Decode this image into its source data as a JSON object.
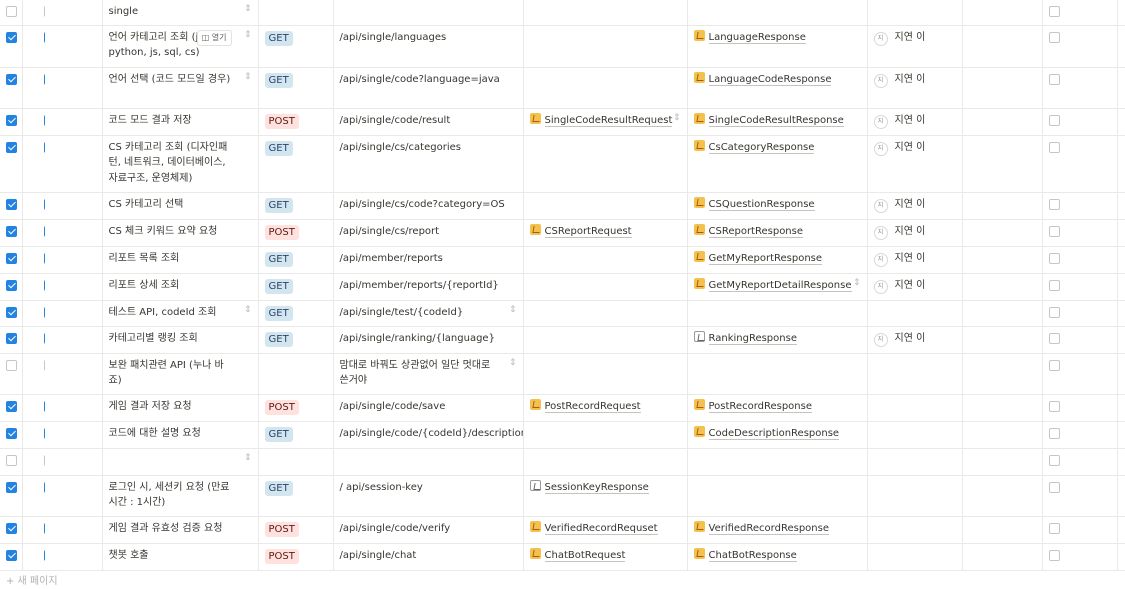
{
  "rows": [
    {
      "chk_a": false,
      "chk_b": false,
      "name": "single",
      "method": "",
      "url": "",
      "request": "",
      "response": "",
      "status": "",
      "chk_c": false
    },
    {
      "chk_a": true,
      "chk_b": true,
      "name": "언어 카테고리 조회\n(java, python, js, sql, cs)",
      "open_label": "열기",
      "method": "GET",
      "url": "/api/single/languages",
      "request": "",
      "response": "LanguageResponse",
      "status": "지연 이",
      "chk_c": false
    },
    {
      "chk_a": true,
      "chk_b": true,
      "name": "언어 선택\n(코드 모드일 경우)",
      "method": "GET",
      "url": "/api/single/code?language=java",
      "request": "",
      "response": "LanguageCodeResponse",
      "status": "지연 이",
      "chk_c": false
    },
    {
      "chk_a": true,
      "chk_b": true,
      "name": "코드 모드 결과 저장",
      "method": "POST",
      "url": "/api/single/code/result",
      "request": "SingleCodeResultRequest",
      "response": "SingleCodeResultResponse",
      "status": "지연 이",
      "chk_c": false
    },
    {
      "chk_a": true,
      "chk_b": true,
      "name": "CS 카테고리 조회\n(디자인패턴, 네트워크, 데이터베이스, 자료구조, 운영체제)",
      "method": "GET",
      "url": "/api/single/cs/categories",
      "request": "",
      "response": "CsCategoryResponse",
      "status": "지연 이",
      "chk_c": false
    },
    {
      "chk_a": true,
      "chk_b": true,
      "name": "CS 카테고리 선택",
      "method": "GET",
      "url": "/api/single/cs/code?category=OS",
      "request": "",
      "response": "CSQuestionResponse",
      "status": "지연 이",
      "chk_c": false
    },
    {
      "chk_a": true,
      "chk_b": true,
      "name": "CS 체크 키워드 요약 요청",
      "method": "POST",
      "url": "/api/single/cs/report",
      "request": "CSReportRequest",
      "response": "CSReportResponse",
      "status": "지연 이",
      "chk_c": false
    },
    {
      "chk_a": true,
      "chk_b": true,
      "name": "리포트 목록 조회",
      "method": "GET",
      "url": "/api/member/reports",
      "request": "",
      "response": "GetMyReportResponse",
      "status": "지연 이",
      "chk_c": false
    },
    {
      "chk_a": true,
      "chk_b": true,
      "name": "리포트 상세 조회",
      "method": "GET",
      "url": "/api/member/reports/{reportId}",
      "request": "",
      "response": "GetMyReportDetailResponse",
      "status": "지연 이",
      "chk_c": false
    },
    {
      "chk_a": true,
      "chk_b": true,
      "name": "테스트 API, codeId 조회",
      "method": "GET",
      "url": "/api/single/test/{codeId}",
      "request": "",
      "response": "",
      "status": "",
      "chk_c": false
    },
    {
      "chk_a": true,
      "chk_b": true,
      "name": "카테고리별 랭킹 조회",
      "method": "GET",
      "url": "/api/single/ranking/{language}",
      "request": "",
      "response": "RankingResponse",
      "status": "지연 이",
      "chk_c": false
    },
    {
      "chk_a": false,
      "chk_b": false,
      "name": "보완 패치관련 API (누나 바죠)",
      "method": "",
      "url": "맘대로 바꿔도 상관없어 일단 멋대로 쓴거야",
      "request": "",
      "response": "",
      "status": "",
      "chk_c": false
    },
    {
      "chk_a": true,
      "chk_b": true,
      "name": "게임 결과 저장 요청",
      "method": "POST",
      "url": "/api/single/code/save",
      "request": "PostRecordRequest",
      "response": "PostRecordResponse",
      "status": "",
      "chk_c": false
    },
    {
      "chk_a": true,
      "chk_b": true,
      "name": "코드에 대한 설명 요청",
      "method": "GET",
      "url": "/api/single/code/{codeId}/description",
      "request": "",
      "response": "CodeDescriptionResponse",
      "status": "",
      "chk_c": false
    },
    {
      "chk_a": false,
      "chk_b": false,
      "name": "",
      "method": "",
      "url": "",
      "request": "",
      "response": "",
      "status": "",
      "chk_c": false
    },
    {
      "chk_a": true,
      "chk_b": true,
      "name": "로그인 시, 세션키 요청 (만료 시간 : 1시간)",
      "method": "GET",
      "url": "/ api/session-key",
      "request": "SessionKeyResponse",
      "response": "",
      "status": "",
      "chk_c": false
    },
    {
      "chk_a": true,
      "chk_b": true,
      "name": "게임 결과 유효성 검증 요청",
      "method": "POST",
      "url": "/api/single/code/verify",
      "request": "VerifiedRecordRequset",
      "response": "VerifiedRecordResponse",
      "status": "",
      "chk_c": false
    },
    {
      "chk_a": true,
      "chk_b": true,
      "name": "챗봇 호출",
      "method": "POST",
      "url": "/api/single/chat",
      "request": "ChatBotRequest",
      "response": "ChatBotResponse",
      "status": "",
      "chk_c": false
    }
  ],
  "footer": {
    "new_page_label": "+ 새 페이지"
  },
  "colors": {
    "checkbox_on": "#2383e2",
    "get_bg": "#d3e5ef",
    "post_bg": "#ffe2dd"
  }
}
